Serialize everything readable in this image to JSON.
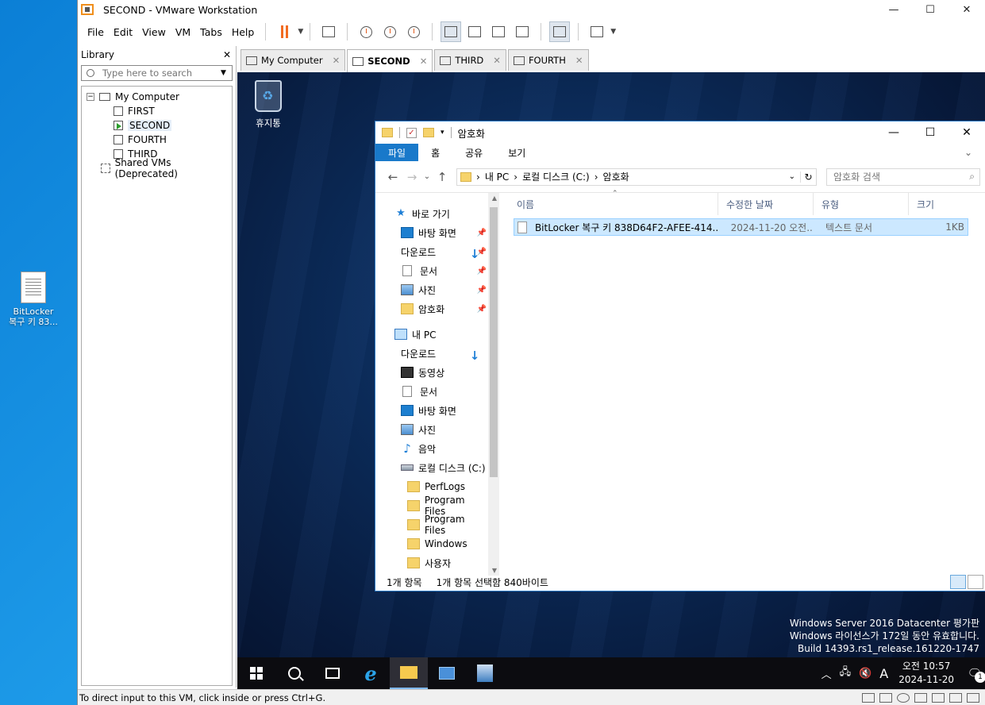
{
  "host": {
    "desktop_icon": {
      "line1": "BitLocker",
      "line2": "복구 키 83..."
    }
  },
  "window": {
    "title": "SECOND - VMware Workstation",
    "controls": {
      "minimize": "—",
      "maximize": "☐",
      "close": "✕"
    }
  },
  "menu": [
    "File",
    "Edit",
    "View",
    "VM",
    "Tabs",
    "Help"
  ],
  "library": {
    "title": "Library",
    "close": "✕",
    "search_placeholder": "Type here to search",
    "root": "My Computer",
    "vms": [
      "FIRST",
      "SECOND",
      "FOURTH",
      "THIRD"
    ],
    "selected": "SECOND",
    "shared": "Shared VMs (Deprecated)"
  },
  "tabs": [
    {
      "label": "My Computer",
      "active": false
    },
    {
      "label": "SECOND",
      "active": true
    },
    {
      "label": "THIRD",
      "active": false
    },
    {
      "label": "FOURTH",
      "active": false
    }
  ],
  "guest": {
    "recycle_bin": "휴지통",
    "explorer": {
      "title": "암호화",
      "ribbon_tabs": [
        "파일",
        "홈",
        "공유",
        "보기"
      ],
      "breadcrumb": [
        "내 PC",
        "로컬 디스크 (C:)",
        "암호화"
      ],
      "search_placeholder": "암호화 검색",
      "nav": {
        "quick_access": "바로 가기",
        "quick_items": [
          "바탕 화면",
          "다운로드",
          "문서",
          "사진",
          "암호화"
        ],
        "this_pc": "내 PC",
        "pc_items": [
          "다운로드",
          "동영상",
          "문서",
          "바탕 화면",
          "사진",
          "음악",
          "로컬 디스크 (C:)"
        ],
        "drive_items": [
          "PerfLogs",
          "Program Files",
          "Program Files",
          "Windows",
          "사용자"
        ]
      },
      "columns": [
        "이름",
        "수정한 날짜",
        "유형",
        "크기"
      ],
      "files": [
        {
          "name": "BitLocker 복구 키 838D64F2-AFEE-414...",
          "modified": "2024-11-20 오전...",
          "type": "텍스트 문서",
          "size": "1KB"
        }
      ],
      "status": {
        "count": "1개 항목",
        "selected": "1개 항목 선택함 840바이트"
      }
    },
    "watermark": {
      "line1": "Windows Server 2016 Datacenter 평가판",
      "line2": "Windows 라이선스가 172일 동안 유효합니다.",
      "line3": "Build 14393.rs1_release.161220-1747"
    },
    "taskbar": {
      "ime": "A",
      "time": "오전 10:57",
      "date": "2024-11-20",
      "notification_count": "1"
    }
  },
  "status_bar": "To direct input to this VM, click inside or press Ctrl+G."
}
